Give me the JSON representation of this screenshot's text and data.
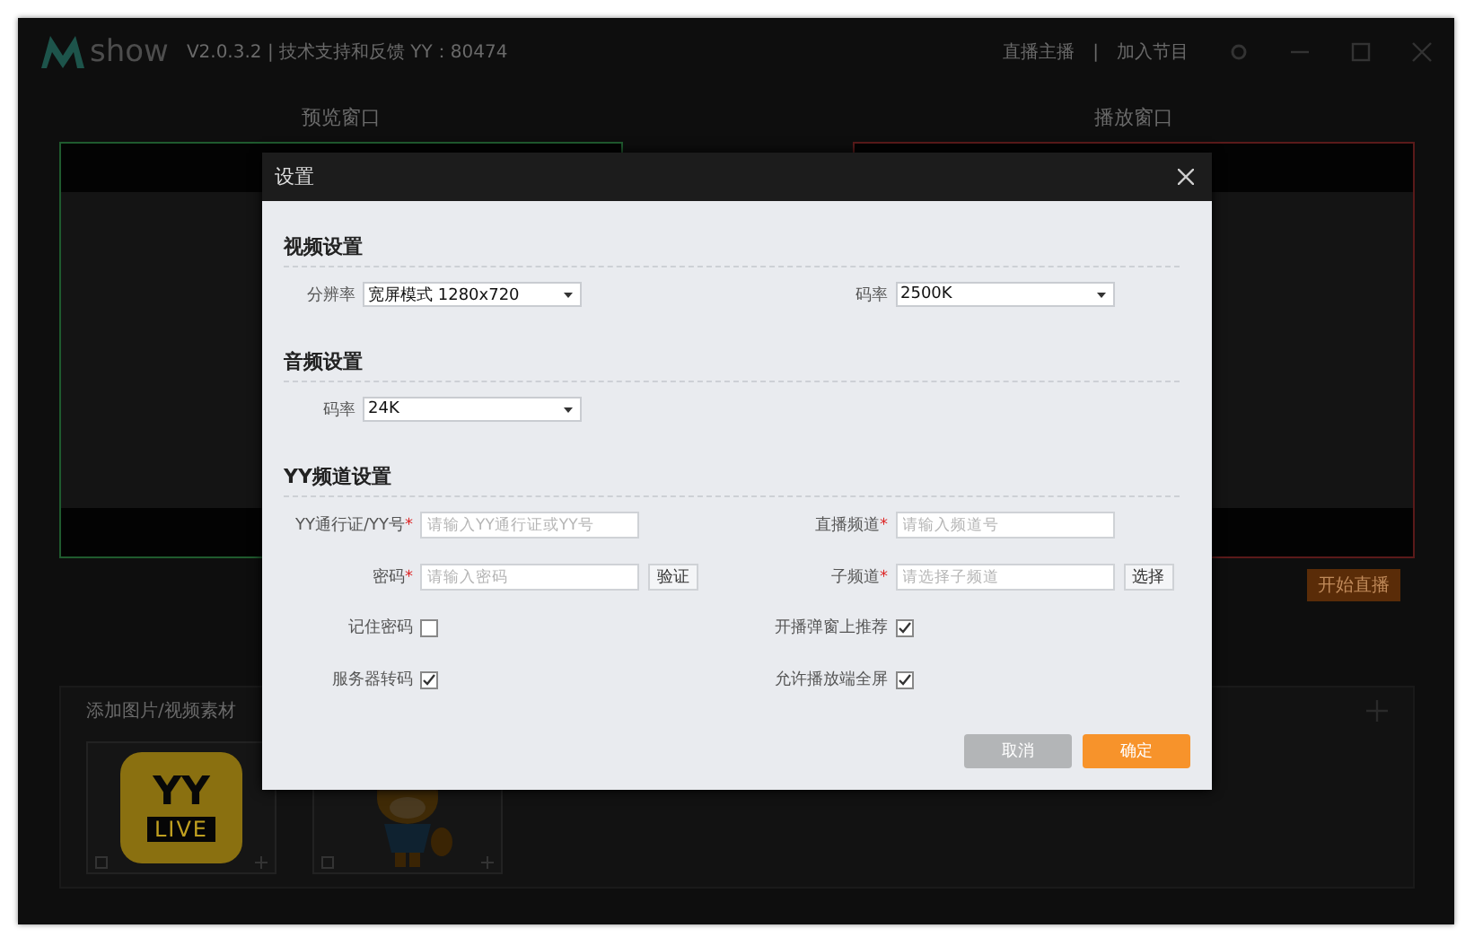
{
  "app": {
    "logo": "show",
    "version": "V2.0.3.2 | 技术支持和反馈 YY：80474",
    "header_links": [
      "直播主播",
      "加入节目"
    ],
    "header_separator": "|"
  },
  "monitors": [
    {
      "label": "预览窗口",
      "color": "#1f5a2e"
    },
    {
      "label": "播放窗口",
      "color": "#5a1a1a"
    }
  ],
  "start_button": "开始直播",
  "materials": {
    "title": "添加图片/视频素材",
    "items": [
      {
        "kind": "logo",
        "lines": [
          "YY",
          "LIVE"
        ]
      },
      {
        "kind": "mascot"
      }
    ]
  },
  "dialog": {
    "title": "设置",
    "required_mark": "*",
    "sections": [
      {
        "title": "视频设置",
        "rows": [
          [
            {
              "kind": "select",
              "label": "分辨率",
              "required": false,
              "value": "宽屏模式 1280x720"
            },
            {
              "kind": "select",
              "label": "码率",
              "required": false,
              "value": "2500K"
            }
          ]
        ]
      },
      {
        "title": "音频设置",
        "rows": [
          [
            {
              "kind": "select",
              "label": "码率",
              "required": false,
              "value": "24K"
            }
          ]
        ]
      },
      {
        "title": "YY频道设置",
        "rows": [
          [
            {
              "kind": "input",
              "label": "YY通行证/YY号",
              "required": true,
              "placeholder": "请输入YY通行证或YY号"
            },
            {
              "kind": "input",
              "label": "直播频道",
              "required": true,
              "placeholder": "请输入频道号"
            }
          ],
          [
            {
              "kind": "input",
              "label": "密码",
              "required": true,
              "placeholder": "请输入密码",
              "button": "验证"
            },
            {
              "kind": "input",
              "label": "子频道",
              "required": true,
              "placeholder": "请选择子频道",
              "button": "选择"
            }
          ],
          [
            {
              "kind": "checkbox",
              "label": "记住密码",
              "checked": false
            },
            {
              "kind": "checkbox",
              "label": "开播弹窗上推荐",
              "checked": true
            }
          ],
          [
            {
              "kind": "checkbox",
              "label": "服务器转码",
              "checked": true
            },
            {
              "kind": "checkbox",
              "label": "允许播放端全屏",
              "checked": true
            }
          ]
        ]
      }
    ],
    "buttons": [
      {
        "label": "取消",
        "kind": "secondary"
      },
      {
        "label": "确定",
        "kind": "primary"
      }
    ]
  }
}
